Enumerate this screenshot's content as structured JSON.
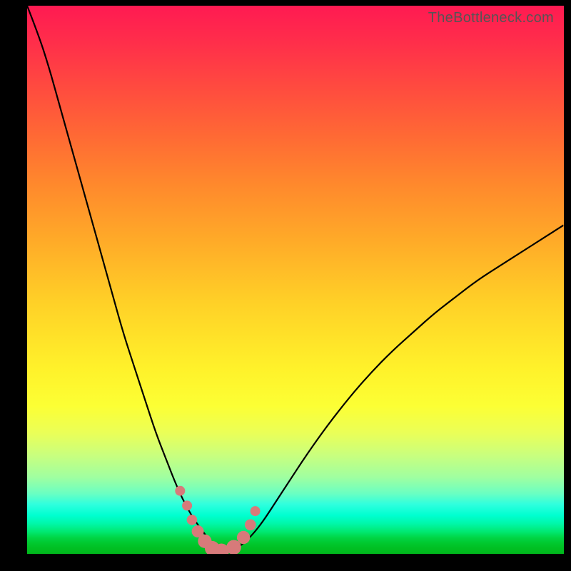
{
  "watermark": "TheBottleneck.com",
  "chart_data": {
    "type": "line",
    "title": "",
    "xlabel": "",
    "ylabel": "",
    "xlim": [
      0,
      100
    ],
    "ylim": [
      0,
      100
    ],
    "series": [
      {
        "name": "bottleneck-curve",
        "x": [
          0,
          2,
          4,
          6,
          8,
          10,
          12,
          14,
          16,
          18,
          20,
          22,
          24,
          26,
          28,
          30,
          32,
          34,
          35,
          36,
          37,
          38,
          40,
          42,
          44,
          46,
          48,
          52,
          56,
          60,
          64,
          68,
          72,
          76,
          80,
          84,
          88,
          92,
          96,
          100
        ],
        "y": [
          100,
          95,
          89,
          82,
          75,
          68,
          61,
          54,
          47,
          40,
          34,
          28,
          22,
          17,
          12,
          8,
          5,
          2.5,
          1.3,
          0.7,
          0.4,
          0.6,
          1.6,
          3.5,
          6,
          9,
          12,
          18,
          23.5,
          28.5,
          33,
          37,
          40.5,
          44,
          47,
          50,
          52.5,
          55,
          57.5,
          60
        ]
      }
    ],
    "markers": {
      "name": "highlight-dots",
      "x": [
        28.5,
        29.8,
        30.7,
        31.8,
        33.1,
        34.5,
        36.2,
        38.5,
        40.3,
        41.6,
        42.5
      ],
      "y": [
        11.5,
        8.8,
        6.2,
        4.1,
        2.3,
        1.0,
        0.5,
        1.2,
        3.0,
        5.3,
        7.8
      ]
    }
  }
}
